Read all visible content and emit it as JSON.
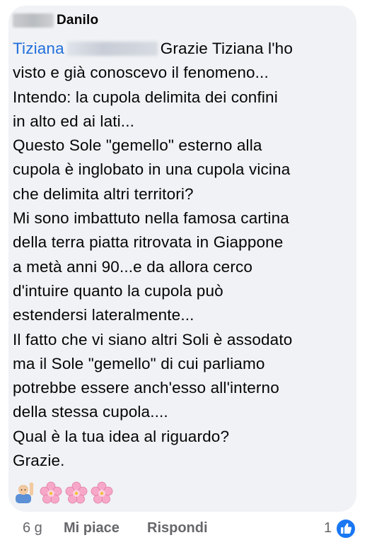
{
  "comment": {
    "author_name": "Danilo",
    "mention": "Tiziana",
    "lines": [
      "Grazie Tiziana l'ho",
      "visto e già conoscevo il fenomeno...",
      "Intendo: la cupola delimita dei confini",
      "in alto ed ai lati...",
      "Questo Sole \"gemello\" esterno alla",
      "cupola è inglobato in una cupola vicina",
      "che delimita altri territori?",
      "Mi sono imbattuto nella famosa cartina",
      "della terra piatta ritrovata in Giappone",
      "a metà anni 90...e da allora cerco",
      "d'intuire quanto la cupola può",
      "estendersi lateralmente...",
      "Il fatto che vi siano altri Soli è assodato",
      "ma il Sole \"gemello\" di cui parliamo",
      "potrebbe essere anch'esso all'interno",
      "della stessa cupola....",
      "Qual è la tua idea al riguardo?",
      "Grazie."
    ],
    "emojis": [
      "person-raising-hand-icon",
      "cherry-blossom-icon",
      "cherry-blossom-icon",
      "cherry-blossom-icon"
    ]
  },
  "footer": {
    "time": "6 g",
    "like_label": "Mi piace",
    "reply_label": "Rispondi",
    "reaction_count": "1"
  },
  "colors": {
    "bubble": "#f0f2f5",
    "mention": "#216fdb",
    "text": "#050505",
    "meta": "#65676b",
    "like_badge": "#1877f2"
  }
}
